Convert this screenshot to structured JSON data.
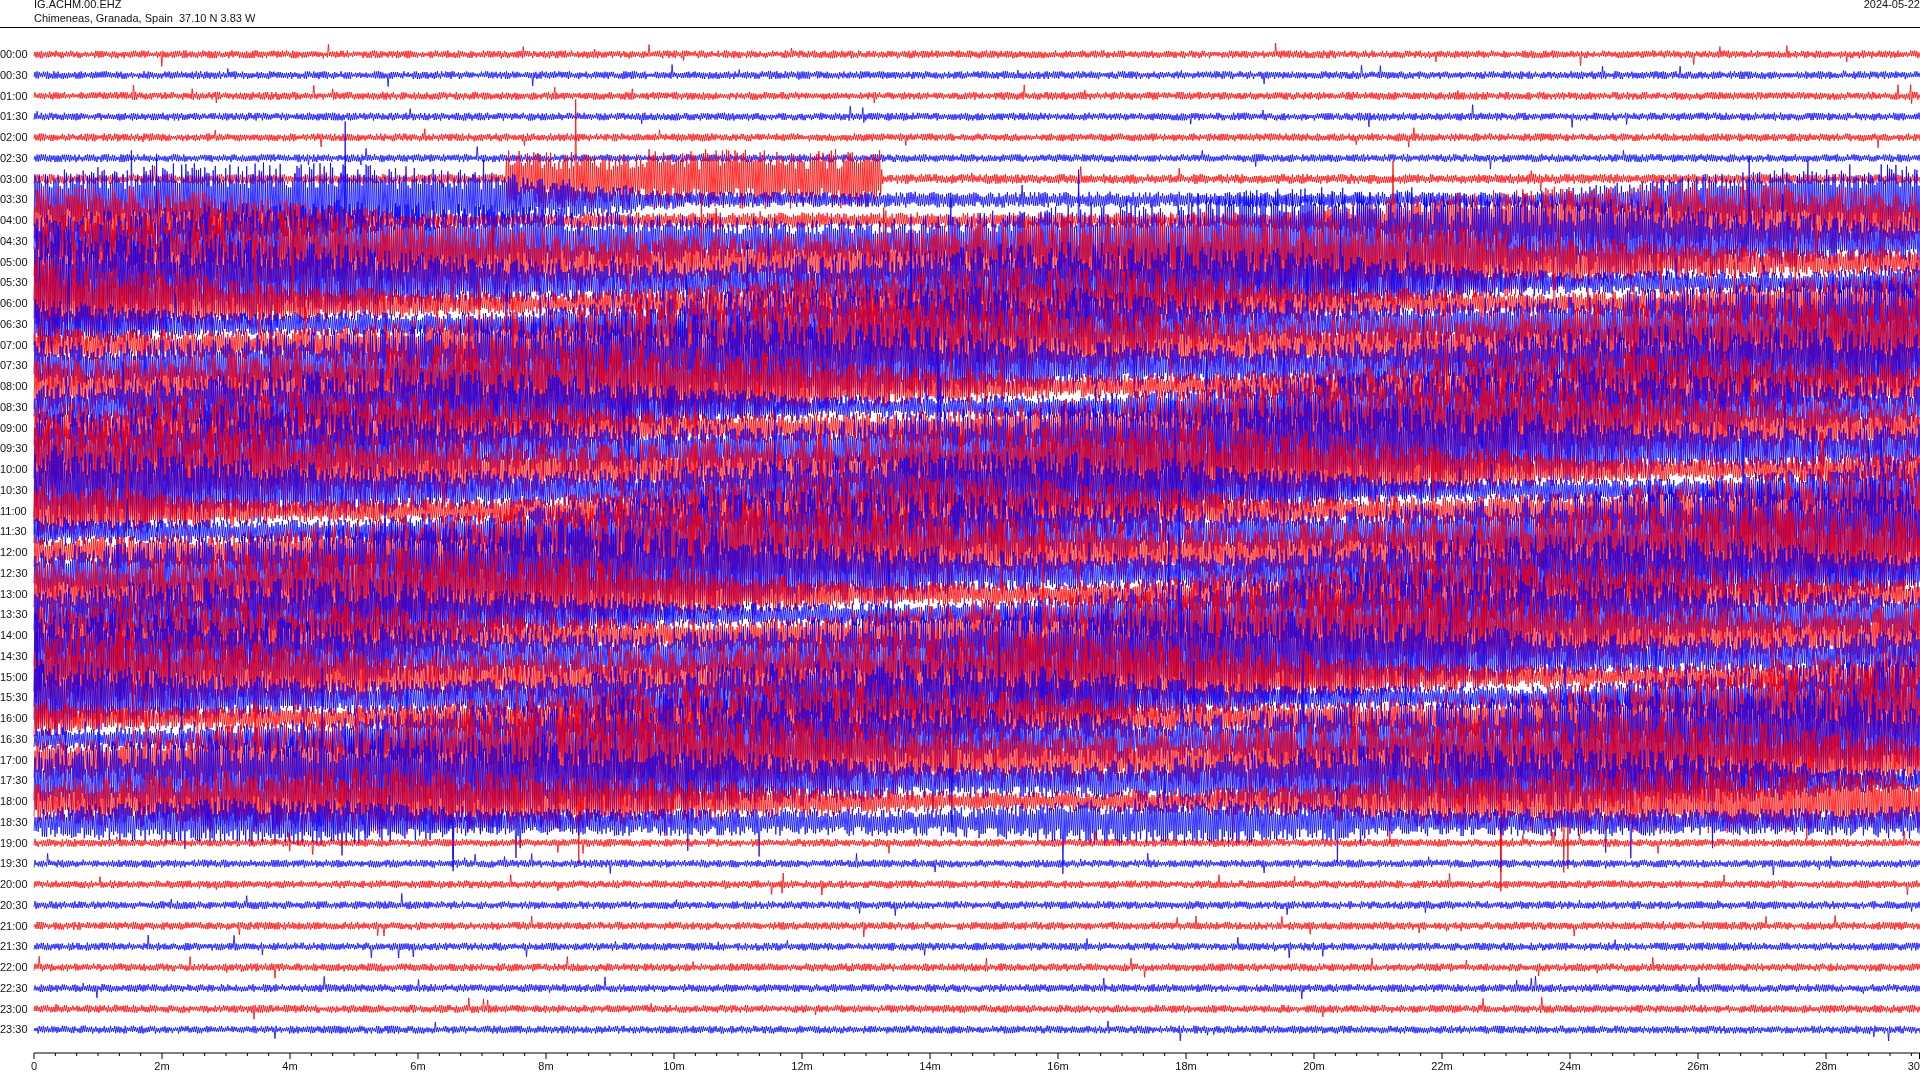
{
  "station": {
    "code": "IG.ACHM.00.EHZ",
    "location": "Chimeneas, Granada, Spain  37.10 N 3.83 W",
    "date": "2024-05-22"
  },
  "rows": [
    {
      "time": "00:00"
    },
    {
      "time": "00:30"
    },
    {
      "time": "01:00"
    },
    {
      "time": "01:30"
    },
    {
      "time": "02:00"
    },
    {
      "time": "02:30"
    },
    {
      "time": "03:00"
    },
    {
      "time": "03:30"
    },
    {
      "time": "04:00"
    },
    {
      "time": "04:30"
    },
    {
      "time": "05:00"
    },
    {
      "time": "05:30"
    },
    {
      "time": "06:00"
    },
    {
      "time": "06:30"
    },
    {
      "time": "07:00"
    },
    {
      "time": "07:30"
    },
    {
      "time": "08:00"
    },
    {
      "time": "08:30"
    },
    {
      "time": "09:00"
    },
    {
      "time": "09:30"
    },
    {
      "time": "10:00"
    },
    {
      "time": "10:30"
    },
    {
      "time": "11:00"
    },
    {
      "time": "11:30"
    },
    {
      "time": "12:00"
    },
    {
      "time": "12:30"
    },
    {
      "time": "13:00"
    },
    {
      "time": "13:30"
    },
    {
      "time": "14:00"
    },
    {
      "time": "14:30"
    },
    {
      "time": "15:00"
    },
    {
      "time": "15:30"
    },
    {
      "time": "16:00"
    },
    {
      "time": "16:30"
    },
    {
      "time": "17:00"
    },
    {
      "time": "17:30"
    },
    {
      "time": "18:00"
    },
    {
      "time": "18:30"
    },
    {
      "time": "19:00"
    },
    {
      "time": "19:30"
    },
    {
      "time": "20:00"
    },
    {
      "time": "20:30"
    },
    {
      "time": "21:00"
    },
    {
      "time": "21:30"
    },
    {
      "time": "22:00"
    },
    {
      "time": "22:30"
    },
    {
      "time": "23:00"
    },
    {
      "time": "23:30"
    }
  ],
  "x_axis": {
    "labels": [
      "0",
      "2m",
      "4m",
      "6m",
      "8m",
      "10m",
      "12m",
      "14m",
      "16m",
      "18m",
      "20m",
      "22m",
      "24m",
      "26m",
      "28m",
      "30"
    ]
  }
}
